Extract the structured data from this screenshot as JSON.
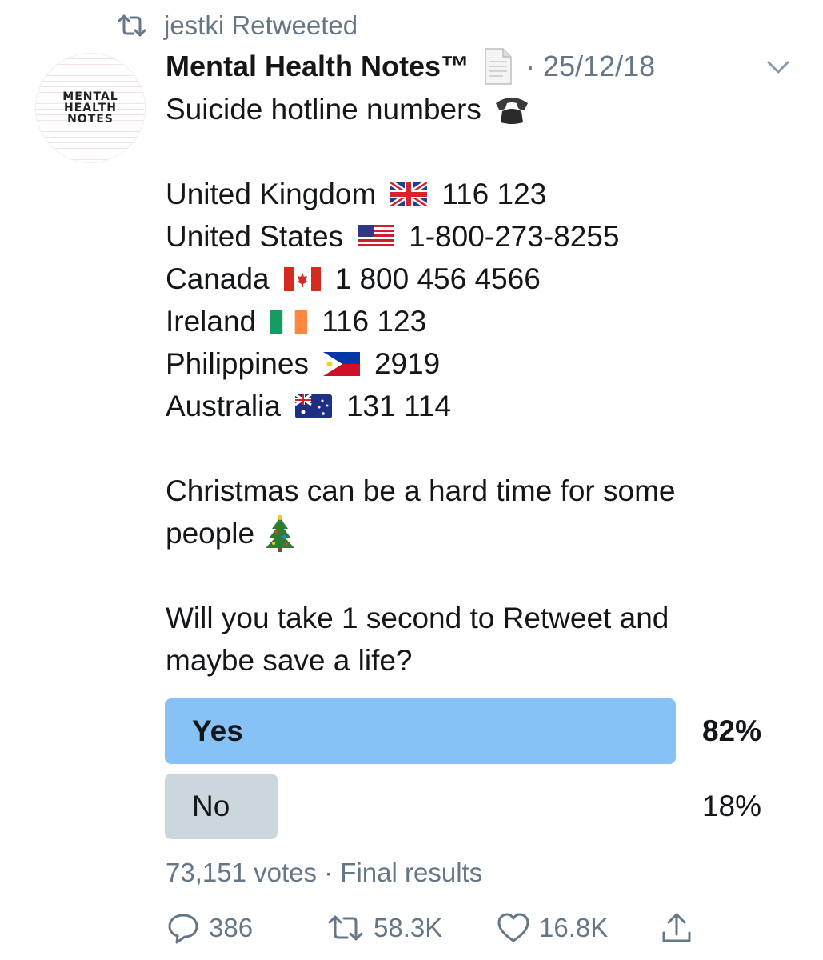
{
  "retweet_context": {
    "text": "jestki Retweeted",
    "icon": "retweet-icon"
  },
  "avatar": {
    "lines": [
      "MENTAL",
      "HEALTH",
      "NOTES"
    ]
  },
  "header": {
    "display_name": "Mental Health Notes™",
    "badge_icon": "page-document-icon",
    "separator_date": "· 25/12/18",
    "menu_icon": "chevron-down-icon"
  },
  "tweet": {
    "intro": "Suicide hotline numbers",
    "hotlines": [
      {
        "country": "United Kingdom",
        "flag": "uk-flag-icon",
        "number": "116 123"
      },
      {
        "country": "United States",
        "flag": "us-flag-icon",
        "number": "1-800-273-8255"
      },
      {
        "country": "Canada",
        "flag": "canada-flag-icon",
        "number": "1 800 456 4566"
      },
      {
        "country": "Ireland",
        "flag": "ireland-flag-icon",
        "number": "116 123"
      },
      {
        "country": "Philippines",
        "flag": "philippines-flag-icon",
        "number": "2919"
      },
      {
        "country": "Australia",
        "flag": "australia-flag-icon",
        "number": "131 114"
      }
    ],
    "para2_line1": "Christmas can be a hard time for some",
    "para2_line2": "people",
    "para3_line1": "Will you take 1 second to Retweet and",
    "para3_line2": "maybe save a life?"
  },
  "poll": {
    "options": [
      {
        "label": "Yes",
        "percent_text": "82%",
        "percent": 82,
        "winner": true
      },
      {
        "label": "No",
        "percent_text": "18%",
        "percent": 18,
        "winner": false
      }
    ],
    "footer": "73,151 votes · Final results"
  },
  "actions": {
    "replies": "386",
    "retweets": "58.3K",
    "likes": "16.8K"
  },
  "colors": {
    "winner_bar": "#86c2f5",
    "loser_bar": "#ccd6dd",
    "secondary_text": "#657786"
  }
}
